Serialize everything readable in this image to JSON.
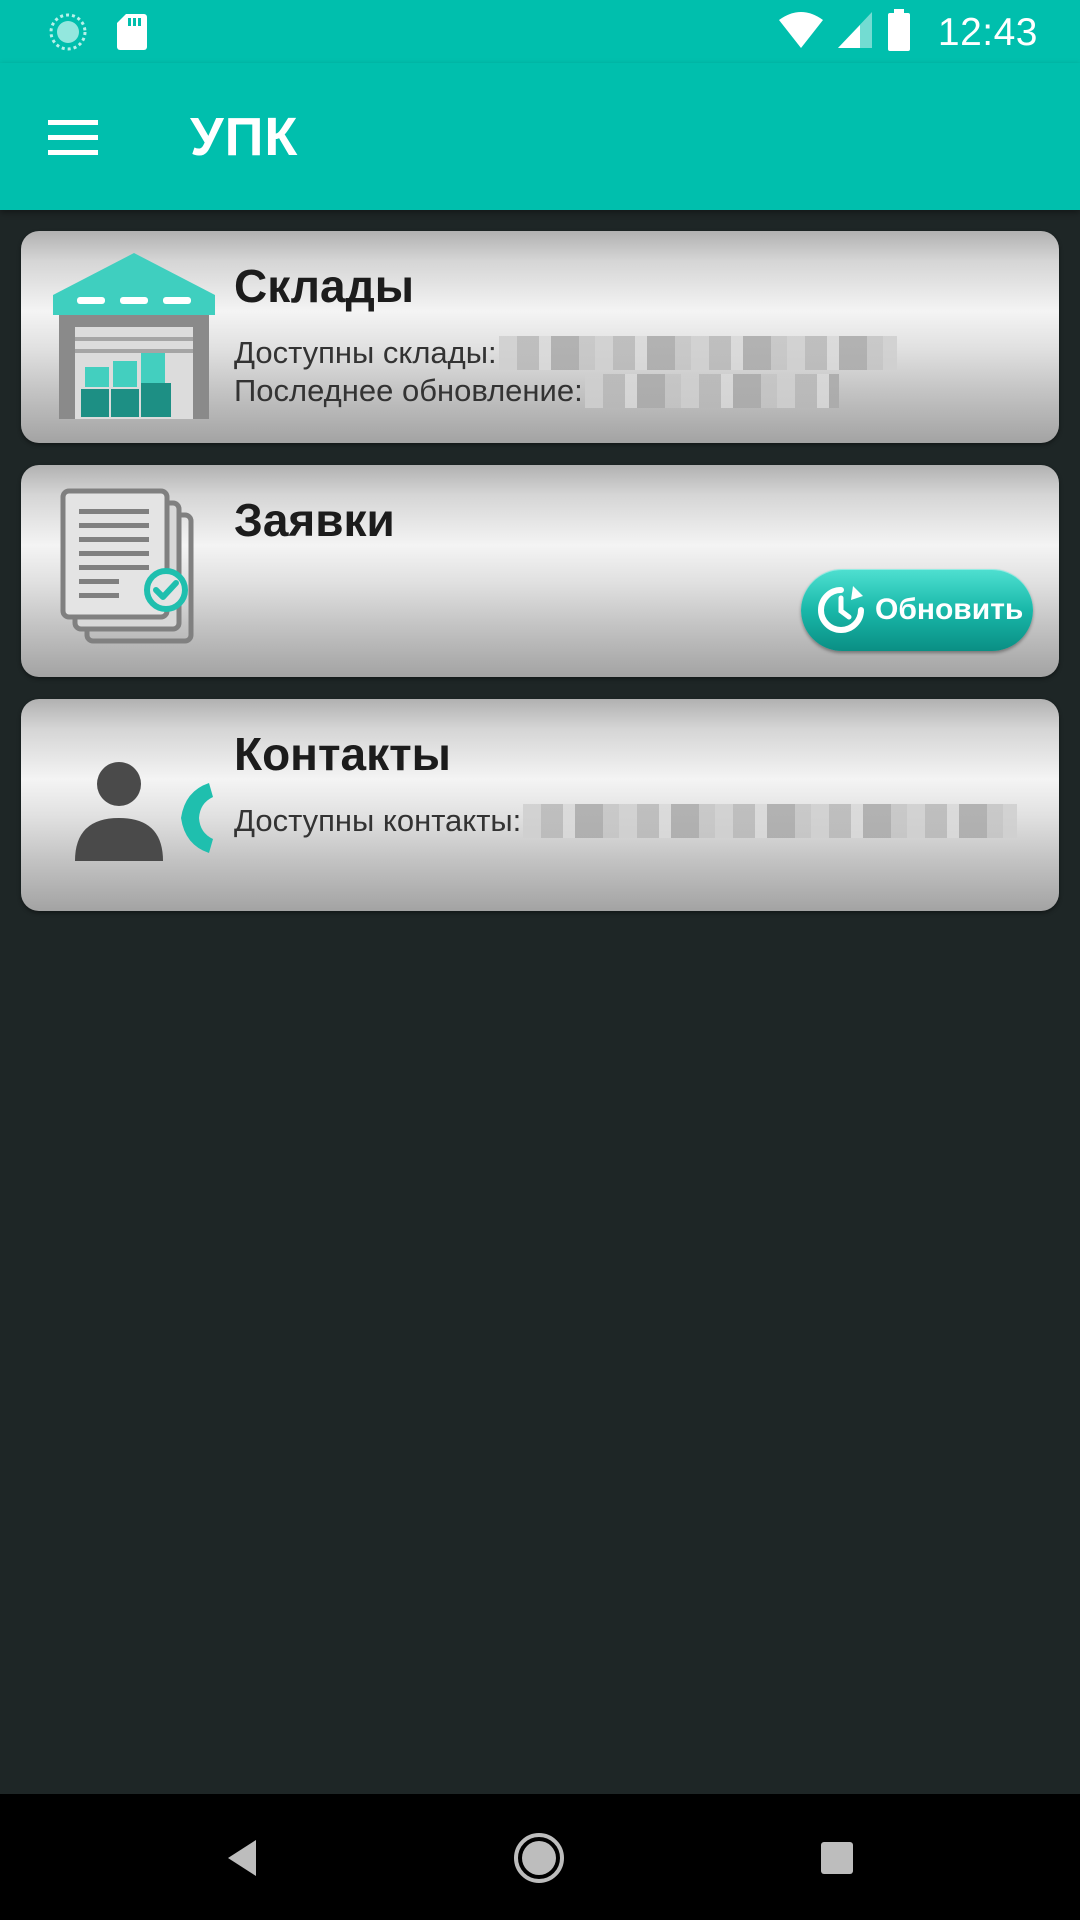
{
  "status_bar": {
    "time": "12:43",
    "icons": [
      "sync-icon",
      "sd-card-icon",
      "wifi-icon",
      "signal-icon",
      "battery-icon"
    ]
  },
  "app_bar": {
    "title": "УПК",
    "menu_icon": "hamburger-menu-icon"
  },
  "cards": {
    "warehouses": {
      "title": "Склады",
      "available_label": "Доступны склады:",
      "updated_label": "Последнее обновление:",
      "icon": "warehouse-icon"
    },
    "requests": {
      "title": "Заявки",
      "refresh_label": "Обновить",
      "icon": "documents-icon"
    },
    "contacts": {
      "title": "Контакты",
      "available_label": "Доступны контакты:",
      "icon": "contact-phone-icon"
    }
  },
  "nav_bar": {
    "icons": [
      "back-icon",
      "home-icon",
      "recents-icon"
    ]
  },
  "colors": {
    "accent": "#00bfad",
    "background": "#1e2626",
    "button": "#19b8a9",
    "icon_gray": "#808080",
    "icon_dark": "#4a4a4a"
  }
}
